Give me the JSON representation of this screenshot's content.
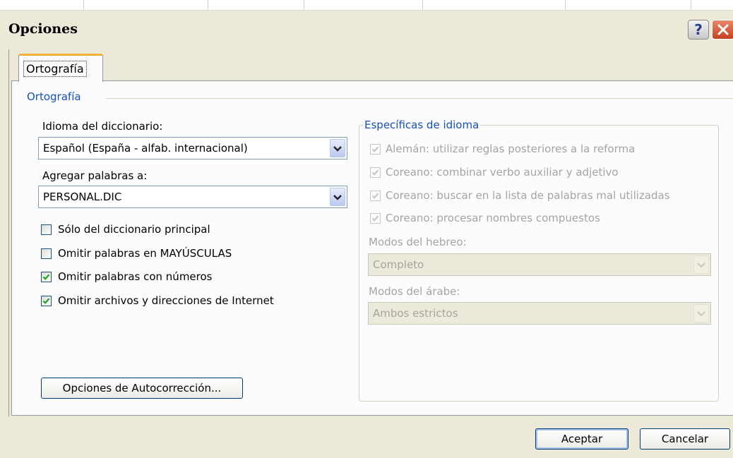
{
  "window": {
    "title": "Opciones",
    "help_label": "?"
  },
  "tab": {
    "label": "Ortografía"
  },
  "spelling": {
    "group_title": "Ortografía",
    "dictionary_language_label": "Idioma del diccionario:",
    "dictionary_language_value": "Español (España - alfab. internacional)",
    "add_words_label": "Agregar palabras a:",
    "add_words_value": "PERSONAL.DIC",
    "options": [
      {
        "label": "Sólo del diccionario principal",
        "checked": false
      },
      {
        "label": "Omitir palabras en MAYÚSCULAS",
        "checked": false
      },
      {
        "label": "Omitir palabras con números",
        "checked": true
      },
      {
        "label": "Omitir archivos y direcciones de Internet",
        "checked": true
      }
    ],
    "autocorrect_button": "Opciones de Autocorrección..."
  },
  "language_specific": {
    "group_title": "Específicas de idioma",
    "options": [
      {
        "label": "Alemán: utilizar reglas posteriores a la reforma",
        "checked": true,
        "enabled": false
      },
      {
        "label": "Coreano: combinar verbo auxiliar y adjetivo",
        "checked": true,
        "enabled": false
      },
      {
        "label": "Coreano: buscar en la lista de palabras mal utilizadas",
        "checked": true,
        "enabled": false
      },
      {
        "label": "Coreano: procesar nombres compuestos",
        "checked": true,
        "enabled": false
      }
    ],
    "hebrew_modes_label": "Modos del hebreo:",
    "hebrew_modes_value": "Completo",
    "arabic_modes_label": "Modos del árabe:",
    "arabic_modes_value": "Ambos estrictos"
  },
  "footer": {
    "ok_label": "Aceptar",
    "cancel_label": "Cancelar"
  },
  "colors": {
    "accent_blue": "#1450B8",
    "dialog_bg": "#ECE9D8",
    "tab_highlight": "#F5B035",
    "close_red": "#C4401F"
  }
}
